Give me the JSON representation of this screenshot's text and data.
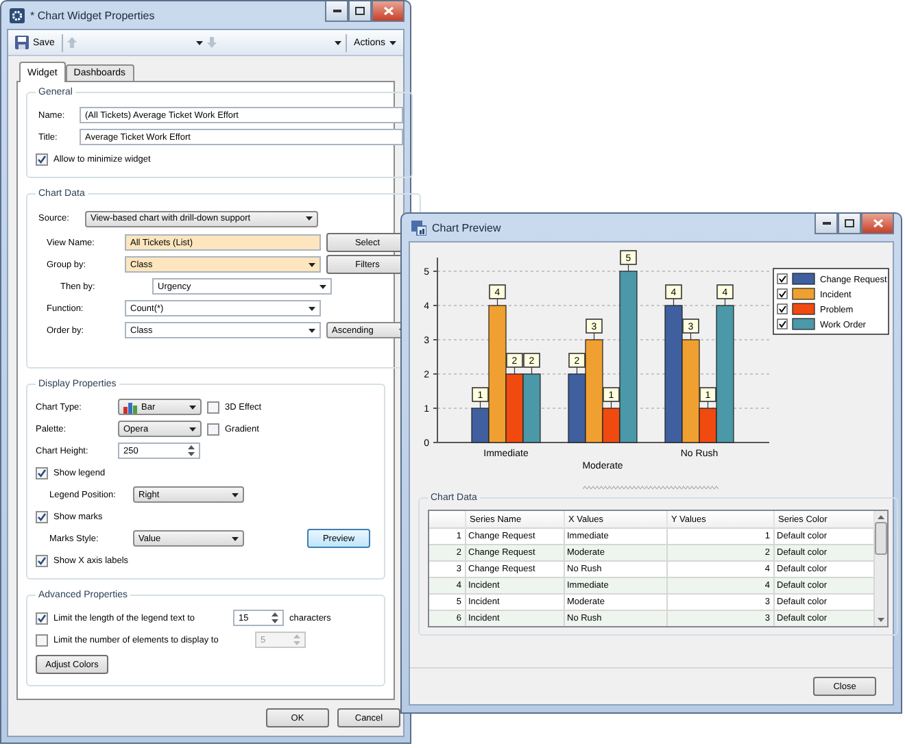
{
  "window": {
    "title": "* Chart Widget Properties"
  },
  "toolbar": {
    "save": "Save",
    "actions": "Actions"
  },
  "tabs": [
    {
      "label": "Widget",
      "selected": true
    },
    {
      "label": "Dashboards",
      "selected": false
    }
  ],
  "general": {
    "title": "General",
    "fields": [
      {
        "label": "Name:",
        "value": "(All Tickets) Average Ticket Work Effort"
      },
      {
        "label": "Title:",
        "value": "Average Ticket Work Effort"
      }
    ],
    "minimize": {
      "label": "Allow to minimize widget",
      "checked": true
    }
  },
  "data_source": {
    "title": "Chart Data",
    "source": {
      "label": "Source:",
      "value": "View-based chart with drill-down support"
    },
    "rows": [
      {
        "label": "View Name:",
        "value": "All Tickets (List)",
        "kind": "text",
        "highlighted": true,
        "nested": false,
        "button": "Select"
      },
      {
        "label": "Group by:",
        "value": "Class",
        "kind": "combo",
        "highlighted": true,
        "nested": false,
        "button": "Filters"
      },
      {
        "label": "Then by:",
        "value": "Urgency",
        "kind": "combo",
        "highlighted": false,
        "nested": true
      },
      {
        "label": "Function:",
        "value": "Count(*)",
        "kind": "combo",
        "highlighted": false,
        "nested": false
      },
      {
        "label": "Order by:",
        "value": "Class",
        "kind": "combo",
        "highlighted": false,
        "nested": false,
        "sort": "Ascending"
      }
    ]
  },
  "display": {
    "title": "Display Properties",
    "chart_type": {
      "label": "Chart Type:",
      "value": "Bar",
      "option": {
        "label": "3D Effect",
        "checked": false
      }
    },
    "palette": {
      "label": "Palette:",
      "value": "Opera",
      "option": {
        "label": "Gradient",
        "checked": false
      }
    },
    "chart_height": {
      "label": "Chart Height:",
      "value": "250"
    },
    "show_legend": {
      "label": "Show legend",
      "checked": true
    },
    "legend_position": {
      "label": "Legend Position:",
      "value": "Right"
    },
    "show_marks": {
      "label": "Show marks",
      "checked": true
    },
    "marks_style": {
      "label": "Marks Style:",
      "value": "Value"
    },
    "preview_button": "Preview",
    "show_x_labels": {
      "label": "Show X axis labels",
      "checked": true
    }
  },
  "advanced": {
    "title": "Advanced Properties",
    "limit_legend": {
      "label": "Limit the length of the legend text to",
      "checked": true,
      "value": "15",
      "suffix": "characters",
      "disabled": false
    },
    "limit_elements": {
      "label": "Limit the number of elements to display to",
      "checked": false,
      "value": "5",
      "disabled": true
    },
    "adjust_colors": "Adjust Colors"
  },
  "footer": [
    "OK",
    "Cancel"
  ],
  "preview": {
    "title": "Chart Preview",
    "chart_data": {
      "type": "bar",
      "categories": [
        "Immediate",
        "Moderate",
        "No Rush"
      ],
      "series": [
        {
          "name": "Change Request",
          "color": "#3f5f9f",
          "values": [
            1,
            2,
            4
          ]
        },
        {
          "name": "Incident",
          "color": "#f0a030",
          "values": [
            4,
            3,
            3
          ]
        },
        {
          "name": "Problem",
          "color": "#f04a10",
          "values": [
            2,
            1,
            1
          ]
        },
        {
          "name": "Work Order",
          "color": "#4a98a8",
          "values": [
            2,
            5,
            4
          ]
        }
      ],
      "ylim": [
        0,
        5.4
      ],
      "yticks": [
        0,
        1,
        2,
        3,
        4,
        5
      ],
      "data_labels": true,
      "grid": true,
      "legend": true
    },
    "legend": [
      {
        "checked": true
      },
      {
        "checked": true
      },
      {
        "checked": true
      },
      {
        "checked": true
      }
    ],
    "table": {
      "title": "Chart Data",
      "columns": [
        "",
        "Series Name",
        "X Values",
        "Y Values",
        "Series Color"
      ],
      "rows": [
        [
          "1",
          "Change Request",
          "Immediate",
          "1",
          "Default color"
        ],
        [
          "2",
          "Change Request",
          "Moderate",
          "2",
          "Default color"
        ],
        [
          "3",
          "Change Request",
          "No Rush",
          "4",
          "Default color"
        ],
        [
          "4",
          "Incident",
          "Immediate",
          "4",
          "Default color"
        ],
        [
          "5",
          "Incident",
          "Moderate",
          "3",
          "Default color"
        ],
        [
          "6",
          "Incident",
          "No Rush",
          "3",
          "Default color"
        ]
      ]
    },
    "close": "Close"
  }
}
